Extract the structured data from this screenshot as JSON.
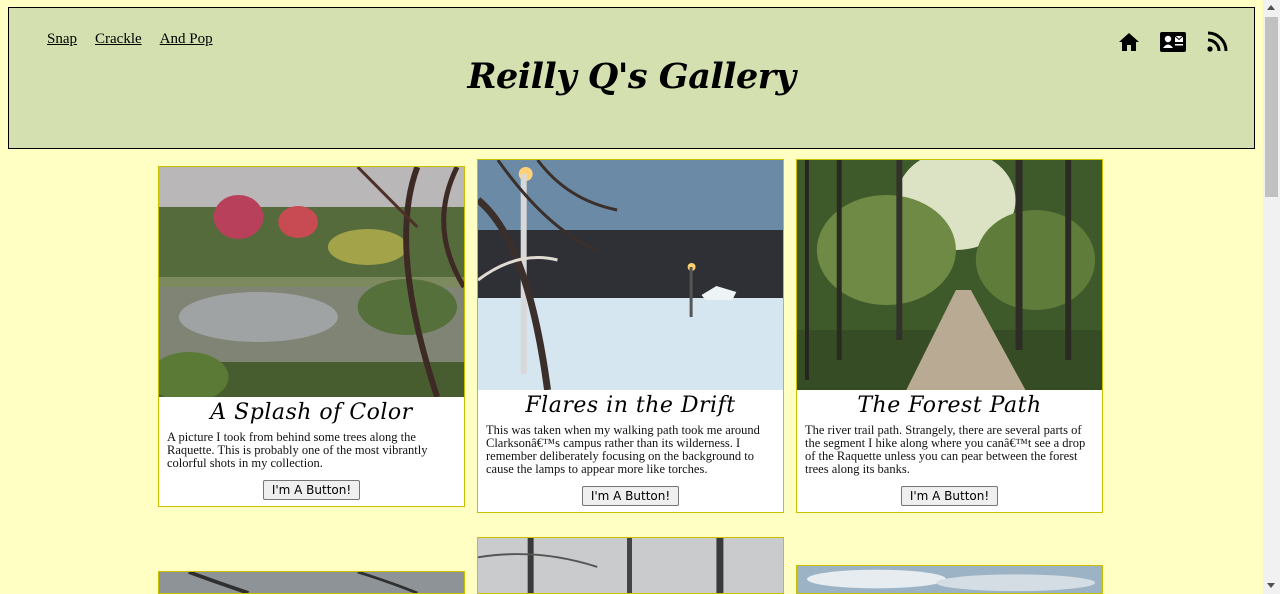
{
  "nav": {
    "links": [
      {
        "label": "Snap"
      },
      {
        "label": "Crackle"
      },
      {
        "label": "And Pop"
      }
    ]
  },
  "header": {
    "title": "Reilly Q's Gallery",
    "icons": [
      "home-icon",
      "contact-card-icon",
      "rss-icon"
    ]
  },
  "cards": [
    {
      "title": "A Splash of Color",
      "description": "A picture I took from behind some trees along the Raquette. This is probably one of the most vibrantly colorful shots in my collection.",
      "button": "I'm A Button!"
    },
    {
      "title": "Flares in the Drift",
      "description": "This was taken when my walking path took me around Clarksonâ€™s campus rather than its wilderness. I remember deliberately focusing on the background to cause the lamps to appear more like torches.",
      "button": "I'm A Button!"
    },
    {
      "title": "The Forest Path",
      "description": "The river trail path. Strangely, there are several parts of the segment I hike along where you canâ€™t see a drop of the Raquette unless you can pear between the forest trees along its banks.",
      "button": "I'm A Button!"
    }
  ],
  "colors": {
    "page_background": "#ffffc4",
    "header_background": "#d4e0b0",
    "card_border": "#c9c000"
  }
}
